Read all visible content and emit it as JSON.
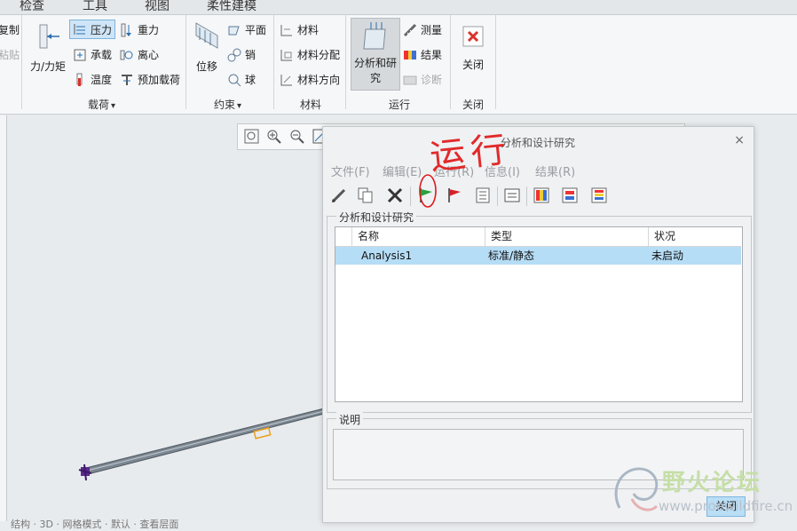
{
  "tabs": [
    "检查",
    "工具",
    "视图",
    "柔性建模"
  ],
  "left_edge": {
    "item1": "复制",
    "item2": "粘贴"
  },
  "loads_group": {
    "big_button": "力/力矩",
    "items": [
      "压力",
      "重力",
      "承载",
      "离心",
      "温度",
      "预加载荷"
    ],
    "label": "载荷",
    "dropdown_glyph": "▾"
  },
  "constraints_group": {
    "big_button": "位移",
    "items": [
      "平面",
      "销",
      "球"
    ],
    "label": "约束",
    "dropdown_glyph": "▾"
  },
  "material_group": {
    "items": [
      "材料",
      "材料分配",
      "材料方向"
    ],
    "label": "材料"
  },
  "run_group": {
    "big_button_line1": "分析和研",
    "big_button_line2": "究",
    "items": [
      "测量",
      "结果",
      "诊断"
    ],
    "label": "运行"
  },
  "close_group": {
    "big_button": "关闭",
    "label": "关闭"
  },
  "dialog": {
    "title": "分析和设计研究",
    "close_glyph": "×",
    "menus": [
      "文件(F)",
      "编辑(E)",
      "运行(R)",
      "信息(I)",
      "结果(R)"
    ],
    "toolbar_icons": [
      "pencil-icon",
      "copy-icon",
      "delete-icon",
      "run-green-flag-icon",
      "stop-red-flag-icon",
      "list-icon",
      "status-icon",
      "results-icon-1",
      "results-icon-2",
      "results-icon-3"
    ],
    "studies_legend": "分析和设计研究",
    "columns": [
      "名称",
      "类型",
      "状况"
    ],
    "rows": [
      {
        "name": "Analysis1",
        "type": "标准/静态",
        "status": "未启动"
      }
    ],
    "description_legend": "说明",
    "description_value": "",
    "close_button": "关闭"
  },
  "annotation": {
    "text": "运行",
    "color": "#e01a1a"
  },
  "status_bar": "结构 · 3D · 网格模式 · 默认 · 查看层面",
  "watermark": {
    "title": "野火论坛",
    "url": "www.proewildfire.cn"
  },
  "colors": {
    "selection": "#b6ddf6",
    "ribbon_bg": "#f6f7f8",
    "accent_blue": "#7fb2dc",
    "red_close": "#d9322b"
  }
}
